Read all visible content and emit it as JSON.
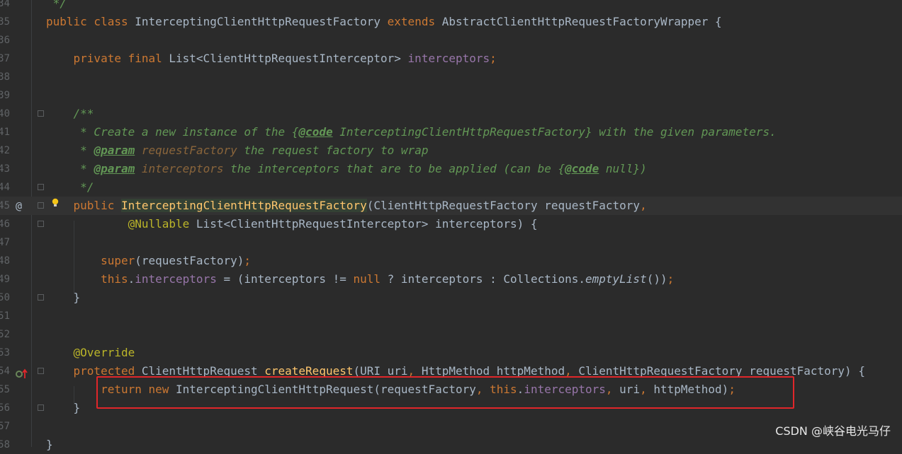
{
  "lines": [
    {
      "num": "34",
      "code": [
        [
          "cmt",
          " */"
        ]
      ]
    },
    {
      "num": "35",
      "code": [
        [
          "kw",
          "public class "
        ],
        [
          "",
          "InterceptingClientHttpRequestFactory "
        ],
        [
          "kw",
          "extends "
        ],
        [
          "",
          "AbstractClientHttpRequestFactoryWrapper {"
        ]
      ]
    },
    {
      "num": "36",
      "code": []
    },
    {
      "num": "37",
      "code": [
        [
          "",
          "    "
        ],
        [
          "kw",
          "private final "
        ],
        [
          "",
          "List<ClientHttpRequestInterceptor> "
        ],
        [
          "fld",
          "interceptors"
        ],
        [
          "kw",
          ";"
        ]
      ]
    },
    {
      "num": "38",
      "code": []
    },
    {
      "num": "39",
      "code": []
    },
    {
      "num": "40",
      "code": [
        [
          "doc",
          "    /**"
        ]
      ]
    },
    {
      "num": "41",
      "code": [
        [
          "doc",
          "     * Create a new instance of the {"
        ],
        [
          "doctag",
          "@code"
        ],
        [
          "doc",
          " InterceptingClientHttpRequestFactory} with the given parameters."
        ]
      ]
    },
    {
      "num": "42",
      "code": [
        [
          "doc",
          "     * "
        ],
        [
          "doctag",
          "@param"
        ],
        [
          "doc",
          " "
        ],
        [
          "docparam",
          "requestFactory"
        ],
        [
          "doc",
          " the request factory to wrap"
        ]
      ]
    },
    {
      "num": "43",
      "code": [
        [
          "doc",
          "     * "
        ],
        [
          "doctag",
          "@param"
        ],
        [
          "doc",
          " "
        ],
        [
          "docparam",
          "interceptors"
        ],
        [
          "doc",
          " the interceptors that are to be applied (can be {"
        ],
        [
          "doctag",
          "@code"
        ],
        [
          "doc",
          " null})"
        ]
      ]
    },
    {
      "num": "44",
      "code": [
        [
          "doc",
          "     */"
        ]
      ]
    },
    {
      "num": "45",
      "code": [
        [
          "",
          "    "
        ],
        [
          "kw",
          "public "
        ],
        [
          "fn-hl",
          "InterceptingClientHttpRequestFactory"
        ],
        [
          "",
          "(ClientHttpRequestFactory requestFactory"
        ],
        [
          "kw",
          ","
        ]
      ]
    },
    {
      "num": "46",
      "code": [
        [
          "",
          "            "
        ],
        [
          "ann",
          "@Nullable "
        ],
        [
          "",
          "List<ClientHttpRequestInterceptor> interceptors) {"
        ]
      ]
    },
    {
      "num": "47",
      "code": []
    },
    {
      "num": "48",
      "code": [
        [
          "",
          "        "
        ],
        [
          "kw",
          "super"
        ],
        [
          "",
          "(requestFactory)"
        ],
        [
          "kw",
          ";"
        ]
      ]
    },
    {
      "num": "49",
      "code": [
        [
          "",
          "        "
        ],
        [
          "kw",
          "this"
        ],
        [
          "",
          "."
        ],
        [
          "fld",
          "interceptors"
        ],
        [
          "",
          " = (interceptors != "
        ],
        [
          "kw",
          "null"
        ],
        [
          "",
          " ? interceptors : Collections."
        ],
        [
          "it",
          "emptyList"
        ],
        [
          "",
          "())"
        ],
        [
          "kw",
          ";"
        ]
      ]
    },
    {
      "num": "50",
      "code": [
        [
          "",
          "    }"
        ]
      ]
    },
    {
      "num": "51",
      "code": []
    },
    {
      "num": "52",
      "code": []
    },
    {
      "num": "53",
      "code": [
        [
          "",
          "    "
        ],
        [
          "ann",
          "@Override"
        ]
      ]
    },
    {
      "num": "54",
      "code": [
        [
          "",
          "    "
        ],
        [
          "kw",
          "protected "
        ],
        [
          "",
          "ClientHttpRequest "
        ],
        [
          "fn",
          "createRequest"
        ],
        [
          "",
          "(URI uri"
        ],
        [
          "kw",
          ", "
        ],
        [
          "",
          "HttpMethod httpMethod"
        ],
        [
          "kw",
          ", "
        ],
        [
          "",
          "ClientHttpRequestFactory requestFactory) {"
        ]
      ]
    },
    {
      "num": "55",
      "code": [
        [
          "",
          "        "
        ],
        [
          "kw",
          "return new "
        ],
        [
          "",
          "InterceptingClientHttpRequest(requestFactory"
        ],
        [
          "kw",
          ", this"
        ],
        [
          "",
          "."
        ],
        [
          "fld",
          "interceptors"
        ],
        [
          "kw",
          ", "
        ],
        [
          "",
          "uri"
        ],
        [
          "kw",
          ", "
        ],
        [
          "",
          "httpMethod)"
        ],
        [
          "kw",
          ";"
        ]
      ]
    },
    {
      "num": "56",
      "code": [
        [
          "",
          "    }"
        ]
      ]
    },
    {
      "num": "57",
      "code": []
    },
    {
      "num": "58",
      "code": [
        [
          "",
          "}"
        ]
      ]
    }
  ],
  "watermark": "CSDN @峡谷电光马仔",
  "gutter": {
    "override_marker": "@"
  }
}
